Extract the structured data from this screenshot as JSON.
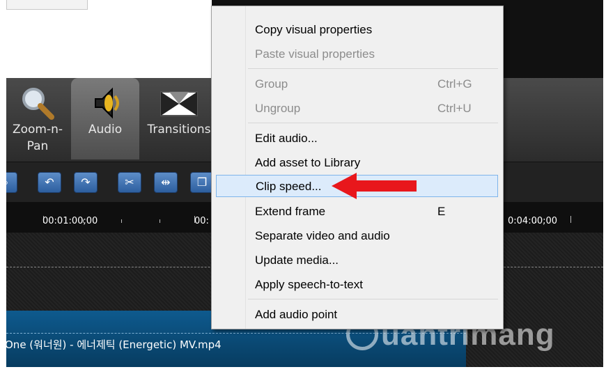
{
  "tools": [
    {
      "label": "Zoom-n-\nPan",
      "icon": "magnifier-icon"
    },
    {
      "label": "Audio",
      "icon": "speaker-icon"
    },
    {
      "label": "Transitions",
      "icon": "transitions-icon"
    }
  ],
  "timeline": {
    "ruler_labels": [
      "00:01:00;00",
      "00:",
      "0:04:00;00"
    ],
    "clip_label": "One (워너원) - 에너제틱 (Energetic) MV.mp4"
  },
  "context_menu": {
    "items": [
      {
        "label": "Copy visual properties",
        "shortcut": "",
        "disabled": false
      },
      {
        "label": "Paste visual properties",
        "shortcut": "",
        "disabled": true
      },
      {
        "label": "Group",
        "shortcut": "Ctrl+G",
        "disabled": true
      },
      {
        "label": "Ungroup",
        "shortcut": "Ctrl+U",
        "disabled": true
      },
      {
        "label": "Edit audio...",
        "shortcut": "",
        "disabled": false
      },
      {
        "label": "Add asset to Library",
        "shortcut": "",
        "disabled": false
      },
      {
        "label": "Clip speed...",
        "shortcut": "",
        "disabled": false,
        "highlighted": true
      },
      {
        "label": "Extend frame",
        "shortcut": "E",
        "disabled": false
      },
      {
        "label": "Separate video and audio",
        "shortcut": "",
        "disabled": false
      },
      {
        "label": "Update media...",
        "shortcut": "",
        "disabled": false
      },
      {
        "label": "Apply speech-to-text",
        "shortcut": "",
        "disabled": false
      },
      {
        "label": "Add audio point",
        "shortcut": "",
        "disabled": false
      }
    ]
  },
  "watermark": {
    "text": "uantrimang"
  },
  "colors": {
    "accent_arrow": "#e8171c",
    "menu_highlight": "#dcebfb",
    "clip": "#0e5a8e"
  }
}
